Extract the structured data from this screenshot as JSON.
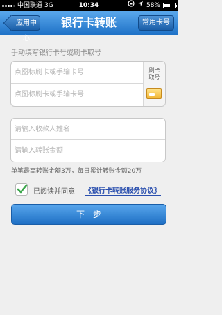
{
  "status_bar": {
    "carrier": "中国联通",
    "network": "3G",
    "time": "10:34",
    "battery": "58%",
    "battery_level": 0.58,
    "icons": [
      "signal-icon",
      "orientation-lock-icon",
      "location-icon",
      "battery-icon"
    ]
  },
  "nav": {
    "title": "银行卡转账",
    "back_label": "应用中心",
    "common_cards_label": "常用卡号"
  },
  "card_section": {
    "label": "手动填写银行卡号或刷卡取号",
    "card_input_1_placeholder": "点图标刷卡或手输卡号",
    "card_input_2_placeholder": "点图标刷卡或手输卡号",
    "swipe_label": "刷卡\n取号",
    "swipe_icon": "card-reader-icon"
  },
  "payee_section": {
    "name_placeholder": "请输入收款人姓名",
    "amount_placeholder": "请输入转账金额"
  },
  "limit_note": "单笔最高转账金额3万，每日累计转账金额20万",
  "agreement": {
    "checked": true,
    "text": "已阅读并同意",
    "link": "《银行卡转账服务协议》"
  },
  "next_button_label": "下一步",
  "colors": {
    "nav_blue": "#1f72c7",
    "button_blue": "#3d8ddb",
    "check_green": "#3aa64a",
    "link_blue": "#2a4fae"
  }
}
